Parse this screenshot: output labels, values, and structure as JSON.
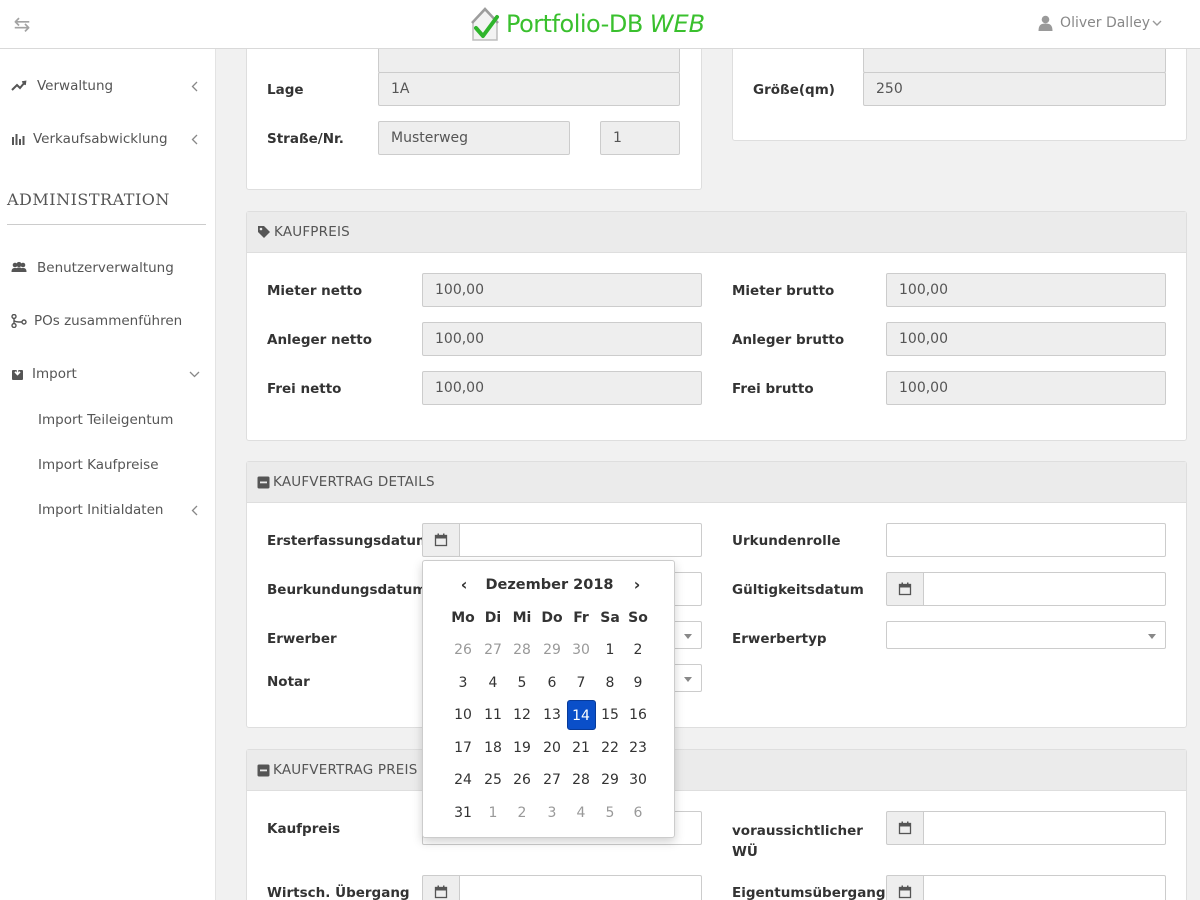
{
  "header": {
    "brand_name": "Portfolio-DB",
    "brand_suffix": "WEB",
    "user_name": "Oliver Dalley"
  },
  "sidebar": {
    "items": [
      {
        "label": "Verwaltung",
        "icon": "line-chart-icon"
      },
      {
        "label": "Verkaufsabwicklung",
        "icon": "bar-chart-icon"
      }
    ],
    "admin_title": "ADMINISTRATION",
    "admin_items": [
      {
        "label": "Benutzerverwaltung",
        "icon": "users-icon"
      },
      {
        "label": "POs zusammenführen",
        "icon": "merge-icon"
      },
      {
        "label": "Import",
        "icon": "import-icon"
      }
    ],
    "import_sub": [
      "Import Teileigentum",
      "Import Kaufpreise",
      "Import Initialdaten"
    ]
  },
  "objekt": {
    "lage_label": "Lage",
    "lage_value": "1A",
    "strasse_label": "Straße/Nr.",
    "strasse_value": "Musterweg",
    "nr_value": "1",
    "groesse_label": "Größe(qm)",
    "groesse_value": "250"
  },
  "kaufpreis": {
    "title": "KAUFPREIS",
    "mieter_netto_label": "Mieter netto",
    "mieter_netto": "100,00",
    "mieter_brutto_label": "Mieter brutto",
    "mieter_brutto": "100,00",
    "anleger_netto_label": "Anleger netto",
    "anleger_netto": "100,00",
    "anleger_brutto_label": "Anleger brutto",
    "anleger_brutto": "100,00",
    "frei_netto_label": "Frei netto",
    "frei_netto": "100,00",
    "frei_brutto_label": "Frei brutto",
    "frei_brutto": "100,00"
  },
  "kaufvertrag_details": {
    "title": "KAUFVERTRAG DETAILS",
    "ersterfassung_label": "Ersterfassungsdatum",
    "urkundenrolle_label": "Urkundenrolle",
    "beurkundung_label": "Beurkundungsdatum",
    "gueltigkeit_label": "Gültigkeitsdatum",
    "erwerber_label": "Erwerber",
    "erwerbertyp_label": "Erwerbertyp",
    "notar_label": "Notar"
  },
  "kaufvertrag_preis": {
    "title": "KAUFVERTRAG PREIS",
    "kaufpreis_label": "Kaufpreis",
    "wue_label_1": "voraussichtlicher",
    "wue_label_2": "WÜ",
    "wirtsch_label": "Wirtsch. Übergang",
    "eigentum_label": "Eigentumsübergang"
  },
  "datepicker": {
    "month_title": "Dezember 2018",
    "prev": "‹",
    "next": "›",
    "weekdays": [
      "Mo",
      "Di",
      "Mi",
      "Do",
      "Fr",
      "Sa",
      "So"
    ],
    "weeks": [
      [
        "26",
        "27",
        "28",
        "29",
        "30",
        "1",
        "2"
      ],
      [
        "3",
        "4",
        "5",
        "6",
        "7",
        "8",
        "9"
      ],
      [
        "10",
        "11",
        "12",
        "13",
        "14",
        "15",
        "16"
      ],
      [
        "17",
        "18",
        "19",
        "20",
        "21",
        "22",
        "23"
      ],
      [
        "24",
        "25",
        "26",
        "27",
        "28",
        "29",
        "30"
      ],
      [
        "31",
        "1",
        "2",
        "3",
        "4",
        "5",
        "6"
      ]
    ],
    "selected": "14"
  },
  "colors": {
    "brand": "#3ac02e",
    "selected_day": "#0a4fc9"
  }
}
